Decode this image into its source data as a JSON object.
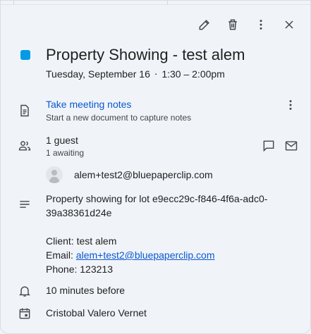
{
  "event": {
    "title": "Property Showing - test alem",
    "date": "Tuesday, September 16",
    "separator": "⋅",
    "time": "1:30 – 2:00pm",
    "color": "#039be5"
  },
  "toolbar": {
    "edit_icon": "pencil-icon",
    "delete_icon": "trash-icon",
    "more_icon": "more-vert-icon",
    "close_icon": "close-icon"
  },
  "notes": {
    "title": "Take meeting notes",
    "subtitle": "Start a new document to capture notes"
  },
  "guests": {
    "count_label": "1 guest",
    "status_label": "1 awaiting",
    "list": [
      {
        "email": "alem+test2@bluepaperclip.com"
      }
    ]
  },
  "description": {
    "line1": "Property showing for lot e9ecc29c-f846-4f6a-adc0-39a38361d24e",
    "client": "Client: test alem",
    "email_prefix": "Email: ",
    "email_link": "alem+test2@bluepaperclip.com",
    "phone": "Phone: 123213"
  },
  "reminder": "10 minutes before",
  "calendar": "Cristobal Valero Vernet",
  "colors": {
    "link": "#0b57d0",
    "background": "#f0f4f9",
    "icon": "#444746"
  }
}
